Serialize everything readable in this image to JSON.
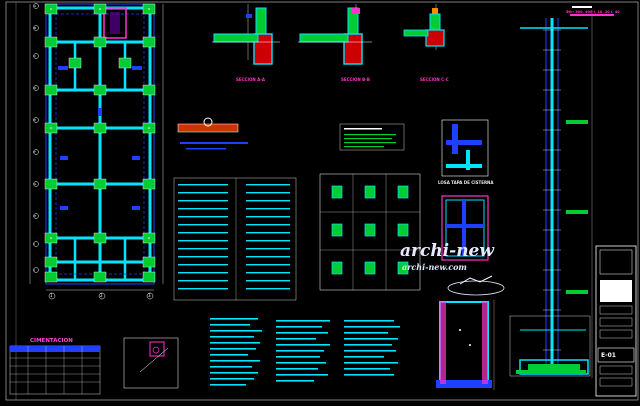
{
  "drawing": {
    "sections": {
      "a": "SECCION A-A",
      "b": "SECCION B-B",
      "c": "SECCION C-C"
    },
    "tank_title": "LOSA TAPA DE CISTERNA",
    "foundation_title": "CIMENTACION",
    "sheet_id": "E-01",
    "watermark_main": "archi-new",
    "watermark_url": "archi-new.com",
    "grid_bottom": [
      "1",
      "2",
      "3"
    ],
    "grid_left": [
      "A",
      "B",
      "C",
      "D",
      "E",
      "F",
      "G",
      "H",
      "I",
      "J",
      "K",
      "L",
      "M"
    ],
    "top_right_note": "5th: 300, 400 I, 10, 10 I, 40"
  },
  "colors": {
    "background": "#000000",
    "concrete": "#00e5ff",
    "rebar": "#ffffff",
    "hatch": "#00cc33",
    "beam": "#1e40ff",
    "label": "#ff33cc",
    "annotation": "#22dd22"
  }
}
